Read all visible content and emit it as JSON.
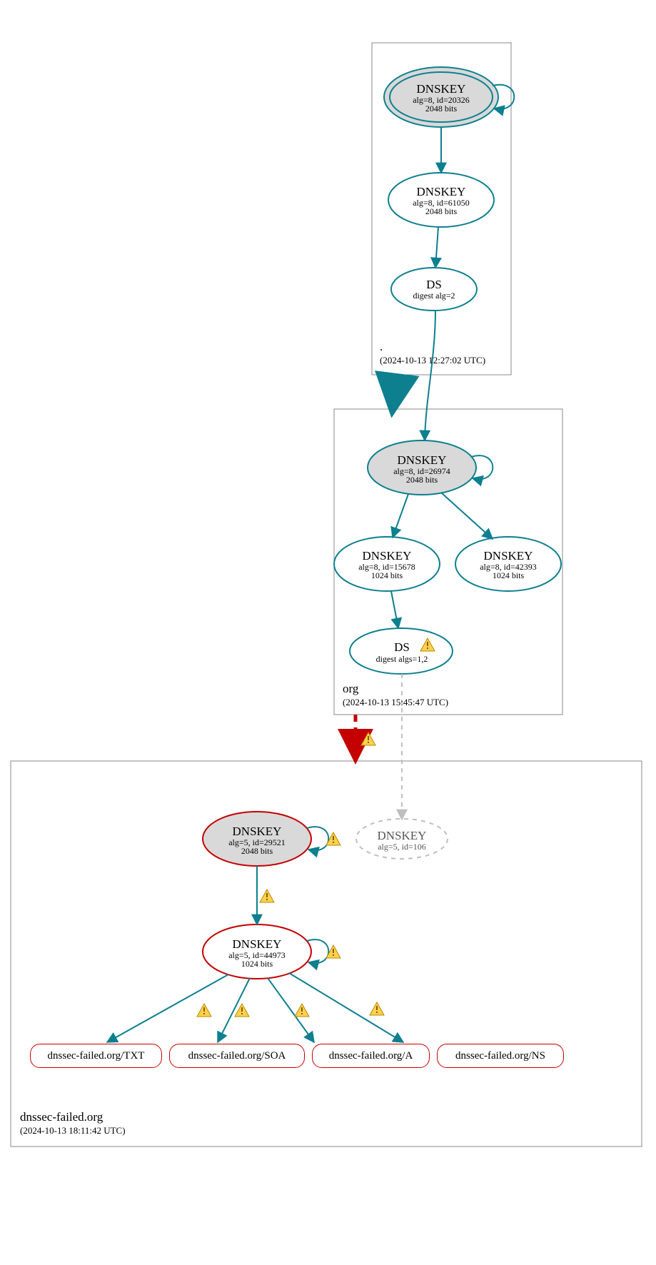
{
  "zones": {
    "root": {
      "name": ".",
      "timestamp": "(2024-10-13 12:27:02 UTC)"
    },
    "org": {
      "name": "org",
      "timestamp": "(2024-10-13 15:45:47 UTC)"
    },
    "failed": {
      "name": "dnssec-failed.org",
      "timestamp": "(2024-10-13 18:11:42 UTC)"
    }
  },
  "nodes": {
    "root_ksk": {
      "title": "DNSKEY",
      "sub1": "alg=8, id=20326",
      "sub2": "2048 bits"
    },
    "root_zsk": {
      "title": "DNSKEY",
      "sub1": "alg=8, id=61050",
      "sub2": "2048 bits"
    },
    "root_ds": {
      "title": "DS",
      "sub1": "digest alg=2",
      "sub2": ""
    },
    "org_ksk": {
      "title": "DNSKEY",
      "sub1": "alg=8, id=26974",
      "sub2": "2048 bits"
    },
    "org_zsk1": {
      "title": "DNSKEY",
      "sub1": "alg=8, id=15678",
      "sub2": "1024 bits"
    },
    "org_zsk2": {
      "title": "DNSKEY",
      "sub1": "alg=8, id=42393",
      "sub2": "1024 bits"
    },
    "org_ds": {
      "title": "DS",
      "sub1": "digest algs=1,2",
      "sub2": ""
    },
    "fail_ksk": {
      "title": "DNSKEY",
      "sub1": "alg=5, id=29521",
      "sub2": "2048 bits"
    },
    "fail_zsk": {
      "title": "DNSKEY",
      "sub1": "alg=5, id=44973",
      "sub2": "1024 bits"
    },
    "fail_ghost": {
      "title": "DNSKEY",
      "sub1": "alg=5, id=106",
      "sub2": ""
    }
  },
  "records": {
    "txt": "dnssec-failed.org/TXT",
    "soa": "dnssec-failed.org/SOA",
    "a": "dnssec-failed.org/A",
    "ns": "dnssec-failed.org/NS"
  },
  "colors": {
    "teal": "#0d7f8f",
    "red": "#c40000",
    "grey": "#bfbfbf",
    "fillGrey": "#d9d9d9"
  }
}
